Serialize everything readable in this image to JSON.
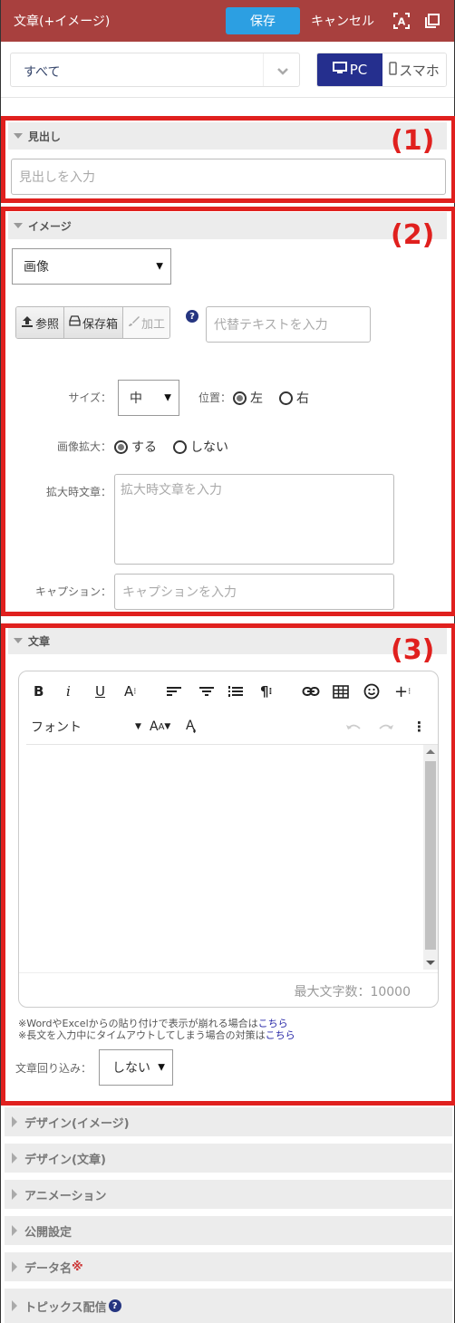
{
  "header": {
    "title": "文章(+イメージ)",
    "save_label": "保存",
    "cancel_label": "キャンセル",
    "icons": [
      "text-recognition-icon",
      "copy-icon"
    ]
  },
  "device_row": {
    "scope_value": "すべて",
    "pc_label": "PC",
    "sp_label": "スマホ",
    "active_device": "PC"
  },
  "sections": {
    "heading": {
      "title": "見出し",
      "placeholder": "見出しを入力"
    },
    "image": {
      "title": "イメージ",
      "type_select": "画像",
      "browse_label": "参照",
      "storage_label": "保存箱",
      "edit_label": "加工",
      "alt_placeholder": "代替テキストを入力",
      "size_label": "サイズ：",
      "size_value": "中",
      "position_label": "位置：",
      "position_options": [
        "左",
        "右"
      ],
      "position_selected": "左",
      "zoom_label": "画像拡大：",
      "zoom_options": [
        "する",
        "しない"
      ],
      "zoom_selected": "する",
      "zoom_text_label": "拡大時文章：",
      "zoom_text_placeholder": "拡大時文章を入力",
      "caption_label": "キャプション：",
      "caption_placeholder": "キャプションを入力"
    },
    "text": {
      "title": "文章",
      "toolbar1": [
        "B",
        "i",
        "U",
        "A⁝",
        "align-left",
        "align-center",
        "ordered-list",
        "¶⁝",
        "link",
        "table",
        "emoji",
        "+⁝"
      ],
      "font_label": "フォント",
      "max_chars": "最大文字数：10000",
      "note1_prefix": "※WordやExcelからの貼り付けで表示が崩れる場合は",
      "note1_link": "こちら",
      "note2_prefix": "※長文を入力中にタイムアウトしてしまう場合の対策は",
      "note2_link": "こちら",
      "wrap_label": "文章回り込み：",
      "wrap_value": "しない"
    }
  },
  "collapsed_sections": [
    {
      "label": "デザイン(イメージ)"
    },
    {
      "label": "デザイン(文章)"
    },
    {
      "label": "アニメーション"
    },
    {
      "label": "公開設定"
    },
    {
      "label": "データ名",
      "required_mark": "※"
    },
    {
      "label": "トピックス配信",
      "help": "?"
    }
  ],
  "annotations": {
    "box1": "(1)",
    "box2": "(2)",
    "box3": "(3)"
  },
  "colors": {
    "header_bg": "#a8403e",
    "save_btn": "#2c9fe2",
    "pc_active": "#252f8e",
    "annotation_red": "#e0201e",
    "help_icon": "#253580"
  }
}
